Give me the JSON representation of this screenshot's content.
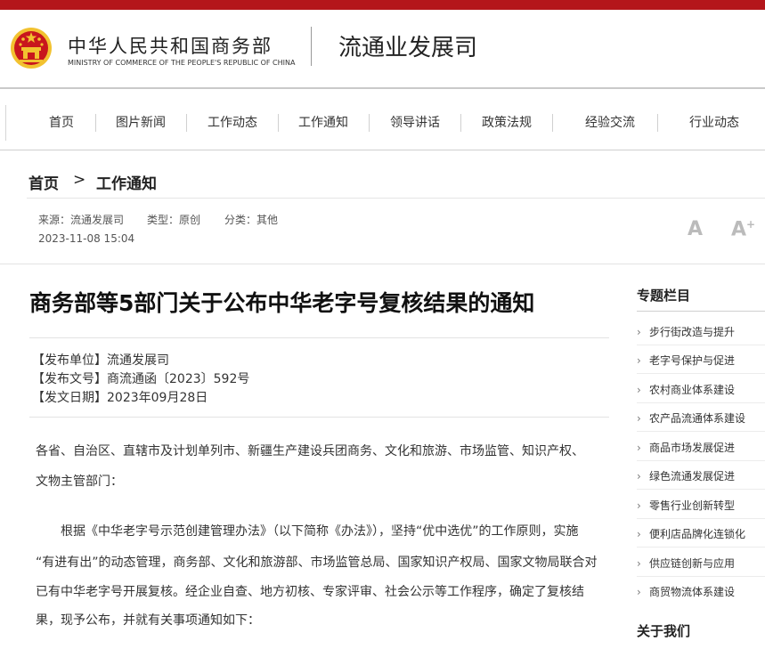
{
  "header": {
    "ministry_cn": "中华人民共和国商务部",
    "ministry_en": "MINISTRY OF COMMERCE OF THE PEOPLE'S REPUBLIC OF CHINA",
    "department": "流通业发展司"
  },
  "nav": {
    "items": [
      "首页",
      "图片新闻",
      "工作动态",
      "工作通知",
      "领导讲话",
      "政策法规",
      "经验交流",
      "行业动态"
    ]
  },
  "breadcrumb": {
    "home": "首页",
    "separator": ">",
    "current": "工作通知"
  },
  "meta": {
    "source": "来源：流通发展司",
    "type": "类型：原创",
    "category": "分类：其他",
    "datetime": "2023-11-08 15:04",
    "font_decrease": "A",
    "font_increase": "A",
    "font_increase_sign": "+"
  },
  "article": {
    "title": "商务部等5部门关于公布中华老字号复核结果的通知",
    "publisher": "【发布单位】流通发展司",
    "doc_number": "【发布文号】商流通函〔2023〕592号",
    "issue_date": "【发文日期】2023年09月28日",
    "body_lines": [
      "各省、自治区、直辖市及计划单列市、新疆生产建设兵团商务、文化和旅游、市场监管、知识产权、",
      "文物主管部门：",
      "根据《中华老字号示范创建管理办法》（以下简称《办法》），坚持“优中选优”的工作原则，实施",
      "“有进有出”的动态管理，商务部、文化和旅游部、市场监管总局、国家知识产权局、国家文物局联合对",
      "已有中华老字号开展复核。经企业自查、地方初核、专家评审、社会公示等工作程序，确定了复核结",
      "果，现予公布，并就有关事项通知如下："
    ]
  },
  "sidebar": {
    "title": "专题栏目",
    "chevron": "›",
    "items": [
      "步行街改造与提升",
      "老字号保护与促进",
      "农村商业体系建设",
      "农产品流通体系建设",
      "商品市场发展促进",
      "绿色流通发展促进",
      "零售行业创新转型",
      "便利店品牌化连锁化",
      "供应链创新与应用",
      "商贸物流体系建设"
    ],
    "about_title": "关于我们"
  },
  "colors": {
    "brand_red": "#b4161b",
    "emblem_gold": "#f2c230"
  }
}
